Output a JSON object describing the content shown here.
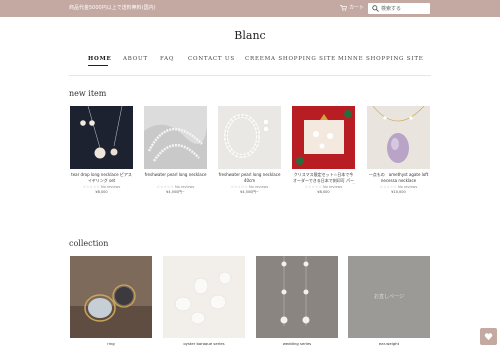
{
  "announcement": {
    "text": "商品代金5000円以上で送料無料(国内)"
  },
  "header": {
    "cart_label": "カート",
    "search_placeholder": "検索する",
    "logo": "Blanc"
  },
  "nav": {
    "items": [
      {
        "label": "HOME",
        "active": true
      },
      {
        "label": "ABOUT"
      },
      {
        "label": "FAQ"
      },
      {
        "label": "CONTACT US"
      },
      {
        "label": "CREEMA SHOPPING SITE"
      },
      {
        "label": "MINNE SHOPPING SITE"
      }
    ]
  },
  "new_items": {
    "title": "new item",
    "products": [
      {
        "title": "tear drop long necklace ピアス イヤリング set",
        "stars": "☆☆☆☆☆",
        "reviews": "No reviews",
        "price": "¥8,000"
      },
      {
        "title": "freshwater pearl long necklace",
        "stars": "☆☆☆☆☆",
        "reviews": "No reviews",
        "price": "¥4,500円~"
      },
      {
        "title": "freshwater pearl long necklace 40cm",
        "stars": "☆☆☆☆☆",
        "reviews": "No reviews",
        "price": "¥4,500円~"
      },
      {
        "title": "クリスマス限定セット☆日本で今オーダーできる日本で刻印可 パールイヤーカフ クリス スターロングチェーン パール",
        "stars": "☆☆☆☆☆",
        "reviews": "No reviews",
        "price": "¥8,000"
      },
      {
        "title": "一点もの　amethyst agate loft necessa necklace",
        "stars": "☆☆☆☆☆",
        "reviews": "No reviews",
        "price": "¥10,000"
      }
    ]
  },
  "collections": {
    "title": "collection",
    "items": [
      {
        "label": "ring"
      },
      {
        "label": "oyster baroque series"
      },
      {
        "label": "wedding series"
      },
      {
        "label": "ear-weight",
        "overlay": "お直しページ"
      }
    ]
  },
  "colors": {
    "brand": "#c4a8a2",
    "text": "#333333"
  },
  "icons": [
    "cart-icon",
    "search-icon",
    "chat-heart-icon"
  ]
}
